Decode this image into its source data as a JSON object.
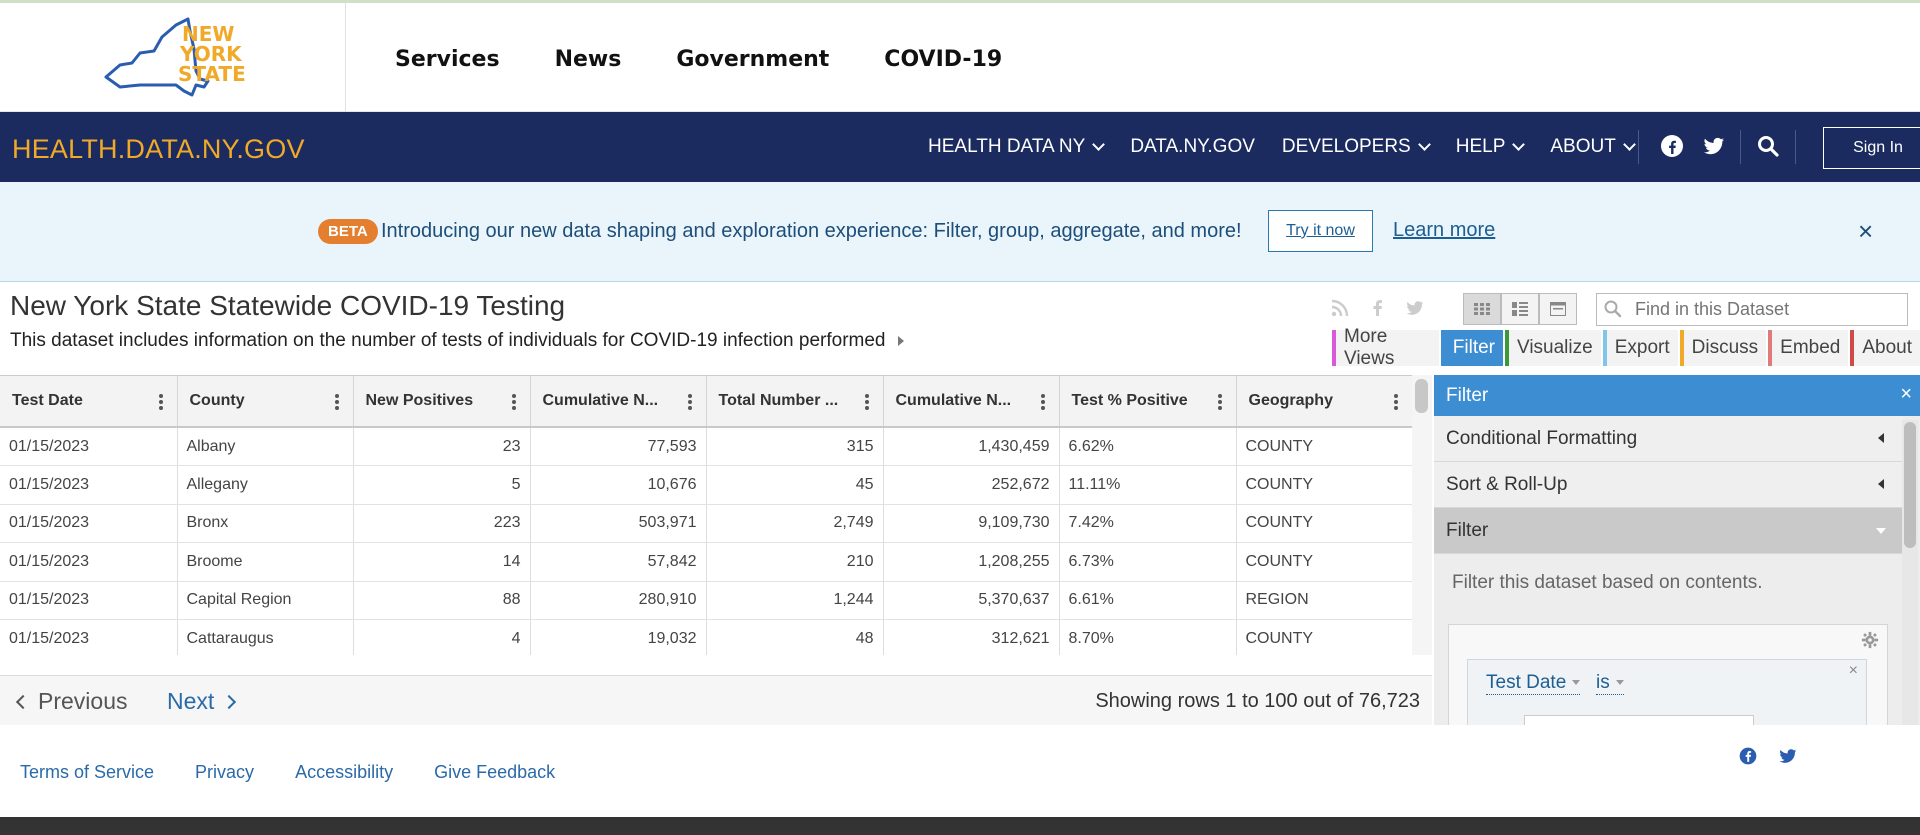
{
  "nys_header": {
    "logo_text": [
      "NEW",
      "YORK",
      "STATE"
    ],
    "nav": [
      "Services",
      "News",
      "Government",
      "COVID-19"
    ]
  },
  "health_bar": {
    "site_title": "HEALTH.DATA.NY.GOV",
    "nav": [
      {
        "label": "HEALTH DATA NY",
        "dropdown": true
      },
      {
        "label": "DATA.NY.GOV",
        "dropdown": false
      },
      {
        "label": "DEVELOPERS",
        "dropdown": true
      },
      {
        "label": "HELP",
        "dropdown": true
      },
      {
        "label": "ABOUT",
        "dropdown": true
      }
    ],
    "sign_in": "Sign In",
    "brand_color": "#1b2b5f",
    "accent_color": "#f0a928"
  },
  "beta_banner": {
    "badge": "BETA",
    "text": "Introducing our new data shaping and exploration experience: Filter, group, aggregate, and more!",
    "try_button": "Try it now",
    "learn_more": "Learn more",
    "close": "×"
  },
  "dataset": {
    "title": "New York State Statewide COVID-19 Testing",
    "description": "This dataset includes information on the number of tests of individuals for COVID-19 infection performed",
    "find_placeholder": "Find in this Dataset",
    "tabs": [
      {
        "label": "More Views",
        "color": "#d85ad8"
      },
      {
        "label": "Filter",
        "color": "#3c8dd1",
        "active": true
      },
      {
        "label": "Visualize",
        "color": "#3a9a3a"
      },
      {
        "label": "Export",
        "color": "#7fc6e8"
      },
      {
        "label": "Discuss",
        "color": "#f0a928"
      },
      {
        "label": "Embed",
        "color": "#e07a7a"
      },
      {
        "label": "About",
        "color": "#d04a4a"
      }
    ]
  },
  "grid": {
    "columns": [
      "Test Date",
      "County",
      "New Positives",
      "Cumulative N...",
      "Total Number ...",
      "Cumulative N...",
      "Test % Positive",
      "Geography"
    ],
    "rows": [
      [
        "01/15/2023",
        "Albany",
        "23",
        "77,593",
        "315",
        "1,430,459",
        "6.62%",
        "COUNTY"
      ],
      [
        "01/15/2023",
        "Allegany",
        "5",
        "10,676",
        "45",
        "252,672",
        "11.11%",
        "COUNTY"
      ],
      [
        "01/15/2023",
        "Bronx",
        "223",
        "503,971",
        "2,749",
        "9,109,730",
        "7.42%",
        "COUNTY"
      ],
      [
        "01/15/2023",
        "Broome",
        "14",
        "57,842",
        "210",
        "1,208,255",
        "6.73%",
        "COUNTY"
      ],
      [
        "01/15/2023",
        "Capital Region",
        "88",
        "280,910",
        "1,244",
        "5,370,637",
        "6.61%",
        "REGION"
      ],
      [
        "01/15/2023",
        "Cattaraugus",
        "4",
        "19,032",
        "48",
        "312,621",
        "8.70%",
        "COUNTY"
      ]
    ]
  },
  "pager": {
    "previous": "Previous",
    "next": "Next",
    "showing": "Showing rows 1 to 100 out of 76,723"
  },
  "sidebar": {
    "title": "Filter",
    "close": "×",
    "sections": [
      "Conditional Formatting",
      "Sort & Roll-Up",
      "Filter"
    ],
    "filter_desc": "Filter this dataset based on contents.",
    "condition_field": "Test Date",
    "condition_operator": "is"
  },
  "footer": {
    "links": [
      "Terms of Service",
      "Privacy",
      "Accessibility",
      "Give Feedback"
    ]
  }
}
